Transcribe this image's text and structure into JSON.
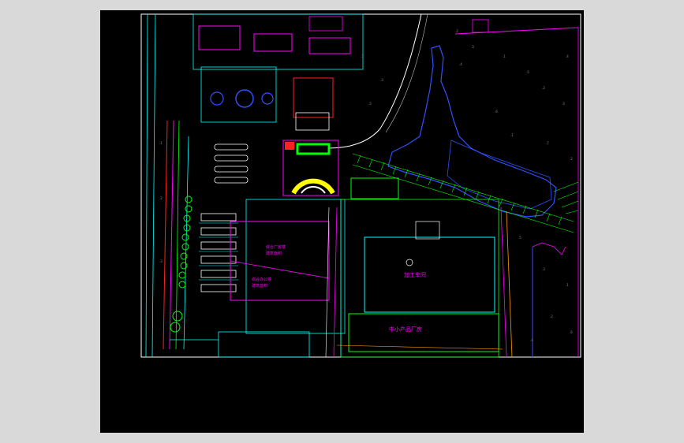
{
  "app": {
    "title": ""
  },
  "palette": {
    "background_outer": "#d9d9d9",
    "paper": "#000000",
    "frame": "#ffffff",
    "cyan": "#00ffff",
    "green": "#00ff00",
    "magenta": "#ff00ff",
    "blue": "#3050ff",
    "yellow": "#ffff00",
    "red": "#ff2020",
    "orange": "#ff9a00",
    "white": "#ffffff"
  },
  "labels": {
    "block_a_line1": "综合厂房楼",
    "block_a_line2": "建筑面积",
    "block_b_line1": "综合办公楼",
    "block_b_line2": "建筑面积",
    "block_c_main": "加工车间",
    "block_d_main": "中小产品厂房"
  }
}
